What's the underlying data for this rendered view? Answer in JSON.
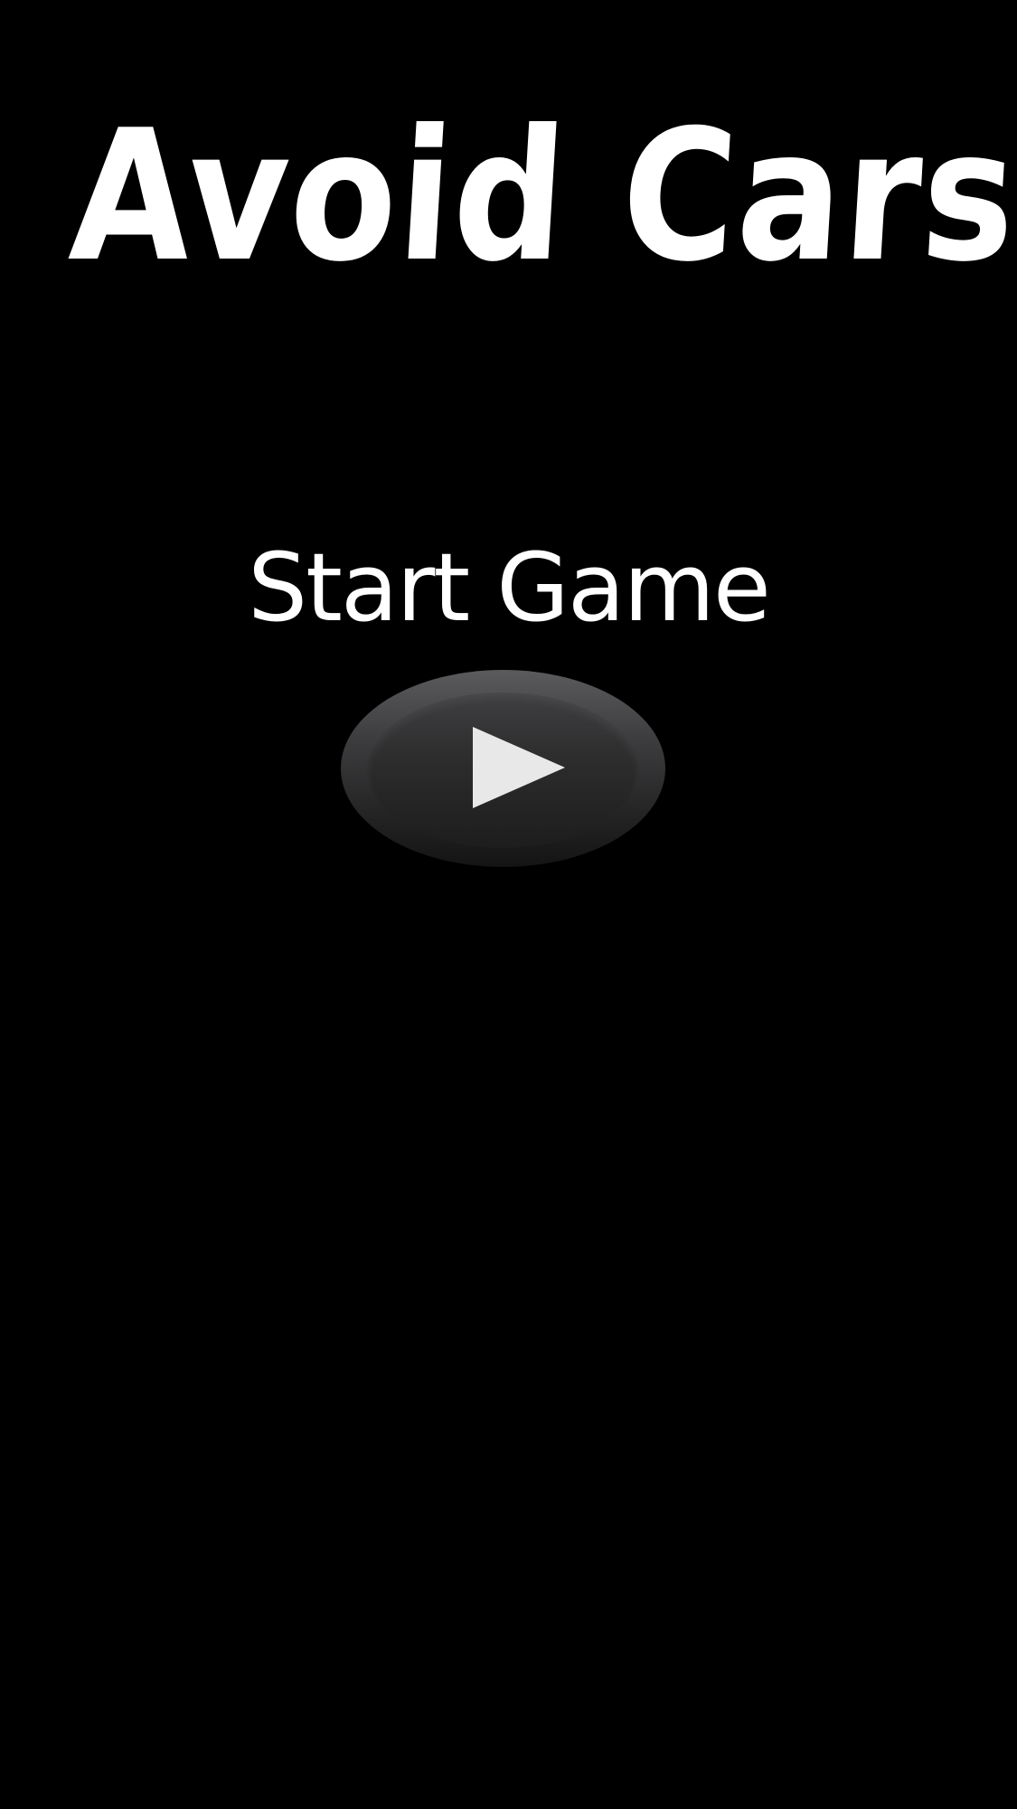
{
  "title": "Avoid Cars",
  "start": {
    "label": "Start Game"
  },
  "play_button": {
    "icon": "play-icon"
  },
  "colors": {
    "background": "#000000",
    "text": "#ffffff",
    "button_top": "#5b5b5d",
    "button_bottom": "#141414",
    "play_icon": "#e8e8e8"
  }
}
